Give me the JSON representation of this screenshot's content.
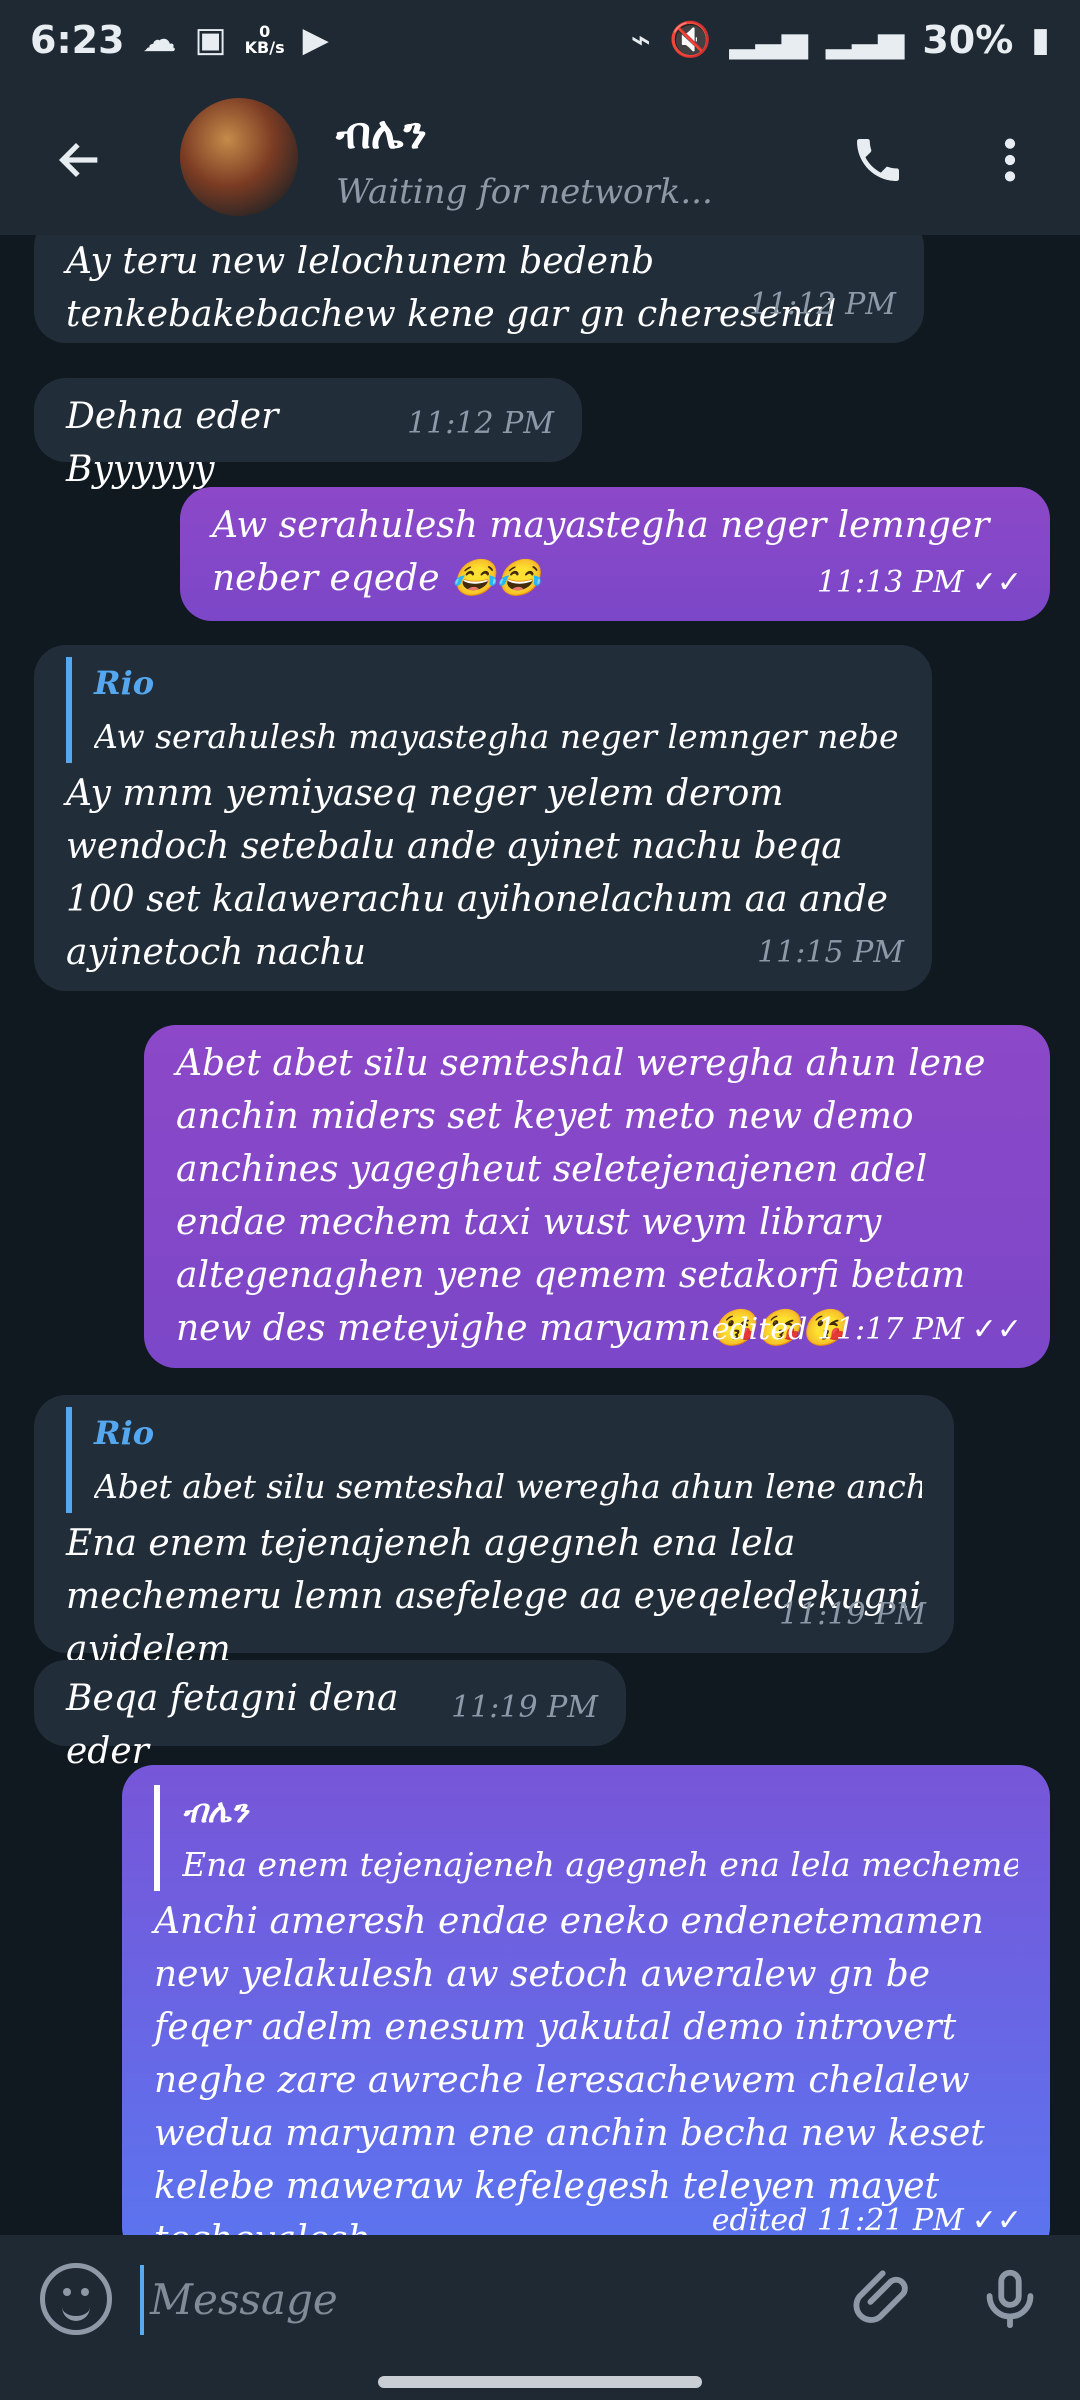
{
  "status_bar": {
    "time": "6:23",
    "network_speed": "0",
    "network_unit": "KB/s",
    "battery_percent": "30%"
  },
  "header": {
    "contact_name": "ብሌን",
    "status": "Waiting for network..."
  },
  "messages": [
    {
      "text": "Ay teru new lelochunem bedenb tenkebakebachew kene gar gn cheresenal",
      "time": "11:12 PM"
    },
    {
      "text": "Dehna eder Byyyyyy",
      "time": "11:12 PM"
    },
    {
      "text": "Aw serahulesh mayastegha neger lemnger neber eqede 😂😂",
      "time": "11:13 PM"
    },
    {
      "reply_name": "Rio",
      "reply_text": "Aw serahulesh mayastegha neger lemnger neber eqede...",
      "text": "Ay mnm yemiyaseq neger yelem derom wendoch setebalu ande ayinet nachu beqa 100 set kalawerachu ayihonelachum aa ande ayinetoch nachu",
      "time": "11:15 PM"
    },
    {
      "text": "Abet abet silu semteshal weregha ahun lene anchin miders set keyet meto new demo anchines yagegheut seletejenajenen adel endae mechem taxi wust weym library altegenaghen yene qemem setakorfi betam new des meteyighe maryamn😘😘😘",
      "time": "edited 11:17 PM"
    },
    {
      "reply_name": "Rio",
      "reply_text": "Abet abet silu semteshal weregha ahun lene anchin m...",
      "text": "Ena enem tejenajeneh agegneh ena lela mechemeru lemn asefelege aa eyeqeledekugni ayidelem",
      "time": "11:19 PM"
    },
    {
      "text": "Beqa fetagni dena eder",
      "time": "11:19 PM"
    },
    {
      "reply_name": "ብሌን",
      "reply_text": "Ena enem tejenajeneh agegneh ena lela mechemeru le...",
      "text": "Anchi ameresh endae eneko endenetemamen new yelakulesh aw setoch aweralew gn be feqer adelm enesum yakutal demo introvert neghe zare awreche leresachewem chelalew wedua maryamn ene anchin becha new keset kelebe maweraw kefelegesh teleyen mayet techeyalesh",
      "time": "edited 11:21 PM"
    }
  ],
  "composer": {
    "placeholder": "Message"
  }
}
